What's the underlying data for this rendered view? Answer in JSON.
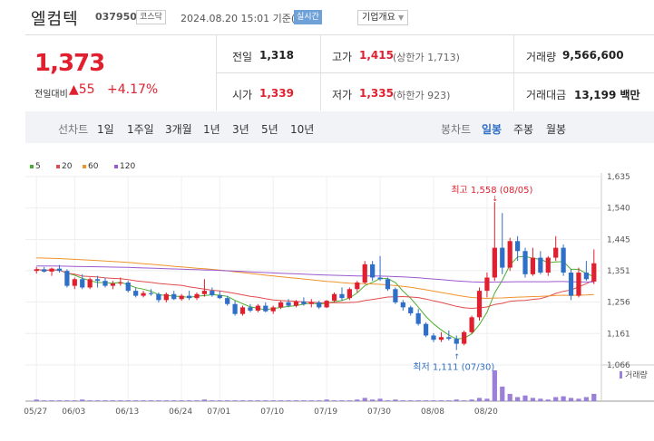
{
  "header": {
    "title": "엘컴텍",
    "code": "037950",
    "market": "코스닥",
    "time": "2024.08.20 15:01 기준(장중)",
    "realtime": "실시간",
    "company_info": "기업개요"
  },
  "quote": {
    "price": "1,373",
    "change_label": "전일대비",
    "change_value": "▲55",
    "change_pct": "+4.17%",
    "prev_close_label": "전일",
    "prev_close": "1,318",
    "open_label": "시가",
    "open": "1,339",
    "high_label": "고가",
    "high": "1,415",
    "upper_limit": "(상한가 1,713)",
    "low_label": "저가",
    "low": "1,335",
    "lower_limit": "(하한가 923)",
    "volume_label": "거래량",
    "volume": "9,566,600",
    "amount_label": "거래대금",
    "amount": "13,199 백만"
  },
  "tabs": {
    "line_head": "선차트",
    "line": [
      "1일",
      "1주일",
      "3개월",
      "1년",
      "3년",
      "5년",
      "10년"
    ],
    "candle_head": "봉차트",
    "candle": [
      "일봉",
      "주봉",
      "월봉"
    ],
    "selected": "일봉"
  },
  "legend": [
    {
      "label": "5",
      "color": "#4caf2f"
    },
    {
      "label": "20",
      "color": "#e24b4b"
    },
    {
      "label": "60",
      "color": "#f0932b"
    },
    {
      "label": "120",
      "color": "#9b59d0"
    }
  ],
  "chart_data": {
    "type": "candlestick",
    "y_ticks": [
      "1,635",
      "1,540",
      "1,445",
      "1,351",
      "1,256",
      "1,161",
      "1,066"
    ],
    "ylim": [
      1066,
      1635
    ],
    "x_tick_labels": [
      "05/27",
      "06/03",
      "06/13",
      "06/24",
      "07/01",
      "07/10",
      "07/19",
      "07/30",
      "08/08",
      "08/20"
    ],
    "volume_label": "거래량",
    "annotations": {
      "high": "최고 1,558 (08/05)",
      "low": "최저 1,111 (07/30)"
    },
    "ohlc": [
      [
        1350,
        1362,
        1342,
        1355
      ],
      [
        1355,
        1362,
        1345,
        1348
      ],
      [
        1348,
        1360,
        1335,
        1357
      ],
      [
        1357,
        1368,
        1345,
        1350
      ],
      [
        1350,
        1355,
        1300,
        1305
      ],
      [
        1305,
        1330,
        1295,
        1325
      ],
      [
        1325,
        1340,
        1295,
        1300
      ],
      [
        1300,
        1330,
        1295,
        1325
      ],
      [
        1325,
        1335,
        1300,
        1320
      ],
      [
        1320,
        1330,
        1300,
        1305
      ],
      [
        1305,
        1320,
        1295,
        1312
      ],
      [
        1312,
        1330,
        1305,
        1315
      ],
      [
        1315,
        1320,
        1285,
        1290
      ],
      [
        1290,
        1300,
        1270,
        1275
      ],
      [
        1275,
        1290,
        1270,
        1283
      ],
      [
        1283,
        1295,
        1275,
        1280
      ],
      [
        1280,
        1285,
        1255,
        1262
      ],
      [
        1262,
        1285,
        1255,
        1280
      ],
      [
        1280,
        1290,
        1262,
        1265
      ],
      [
        1265,
        1280,
        1260,
        1275
      ],
      [
        1275,
        1290,
        1262,
        1268
      ],
      [
        1268,
        1285,
        1262,
        1280
      ],
      [
        1280,
        1325,
        1272,
        1290
      ],
      [
        1290,
        1300,
        1272,
        1277
      ],
      [
        1277,
        1290,
        1265,
        1268
      ],
      [
        1268,
        1275,
        1245,
        1250
      ],
      [
        1250,
        1260,
        1215,
        1220
      ],
      [
        1220,
        1245,
        1215,
        1240
      ],
      [
        1240,
        1250,
        1225,
        1230
      ],
      [
        1230,
        1250,
        1225,
        1245
      ],
      [
        1245,
        1255,
        1225,
        1228
      ],
      [
        1228,
        1245,
        1220,
        1240
      ],
      [
        1240,
        1260,
        1235,
        1255
      ],
      [
        1255,
        1265,
        1240,
        1245
      ],
      [
        1245,
        1262,
        1240,
        1258
      ],
      [
        1258,
        1270,
        1245,
        1250
      ],
      [
        1250,
        1265,
        1240,
        1255
      ],
      [
        1255,
        1260,
        1235,
        1240
      ],
      [
        1240,
        1262,
        1238,
        1260
      ],
      [
        1260,
        1285,
        1255,
        1280
      ],
      [
        1280,
        1300,
        1260,
        1268
      ],
      [
        1268,
        1300,
        1262,
        1295
      ],
      [
        1295,
        1320,
        1285,
        1315
      ],
      [
        1315,
        1380,
        1310,
        1370
      ],
      [
        1370,
        1380,
        1320,
        1330
      ],
      [
        1330,
        1395,
        1320,
        1325
      ],
      [
        1325,
        1330,
        1290,
        1295
      ],
      [
        1295,
        1300,
        1250,
        1255
      ],
      [
        1255,
        1262,
        1230,
        1240
      ],
      [
        1240,
        1245,
        1215,
        1222
      ],
      [
        1222,
        1235,
        1185,
        1190
      ],
      [
        1190,
        1195,
        1150,
        1155
      ],
      [
        1155,
        1162,
        1135,
        1142
      ],
      [
        1142,
        1165,
        1135,
        1150
      ],
      [
        1150,
        1170,
        1140,
        1145
      ],
      [
        1145,
        1155,
        1111,
        1130
      ],
      [
        1130,
        1170,
        1125,
        1165
      ],
      [
        1165,
        1215,
        1160,
        1210
      ],
      [
        1210,
        1300,
        1200,
        1290
      ],
      [
        1290,
        1345,
        1270,
        1330
      ],
      [
        1330,
        1558,
        1320,
        1420
      ],
      [
        1420,
        1525,
        1340,
        1360
      ],
      [
        1360,
        1450,
        1350,
        1440
      ],
      [
        1440,
        1455,
        1380,
        1410
      ],
      [
        1410,
        1420,
        1330,
        1340
      ],
      [
        1340,
        1420,
        1335,
        1390
      ],
      [
        1390,
        1410,
        1340,
        1345
      ],
      [
        1345,
        1395,
        1335,
        1390
      ],
      [
        1390,
        1455,
        1380,
        1420
      ],
      [
        1420,
        1430,
        1335,
        1345
      ],
      [
        1345,
        1355,
        1262,
        1275
      ],
      [
        1275,
        1360,
        1270,
        1345
      ],
      [
        1345,
        1380,
        1320,
        1325
      ],
      [
        1318,
        1415,
        1310,
        1373
      ]
    ],
    "volume": [
      2,
      1,
      1,
      1,
      1,
      1,
      2,
      1,
      1,
      1,
      1,
      1,
      1,
      1,
      1,
      1,
      1,
      1,
      1,
      1,
      1,
      1,
      2,
      1,
      1,
      1,
      1,
      1,
      1,
      1,
      1,
      1,
      1,
      1,
      1,
      1,
      1,
      1,
      2,
      1,
      1,
      1,
      2,
      4,
      2,
      3,
      1,
      2,
      1,
      1,
      1,
      1,
      1,
      1,
      1,
      2,
      1,
      2,
      4,
      3,
      38,
      18,
      9,
      5,
      7,
      4,
      3,
      2,
      5,
      6,
      4,
      3,
      5,
      9
    ]
  }
}
